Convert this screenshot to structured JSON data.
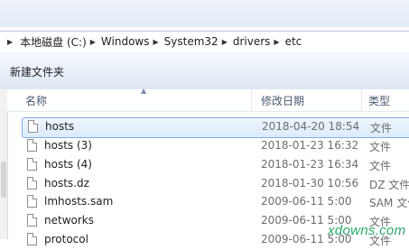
{
  "address": {
    "crumbs": [
      "本地磁盘 (C:)",
      "Windows",
      "System32",
      "drivers",
      "etc"
    ]
  },
  "toolbar": {
    "new_folder_label": "新建文件夹"
  },
  "columns": {
    "name": "名称",
    "date": "修改日期",
    "type": "类型"
  },
  "files": [
    {
      "name": "hosts",
      "date": "2018-04-20 18:54",
      "type": "文件",
      "selected": true
    },
    {
      "name": "hosts (3)",
      "date": "2018-01-23 16:32",
      "type": "文件"
    },
    {
      "name": "hosts (4)",
      "date": "2018-01-23 16:34",
      "type": "文件"
    },
    {
      "name": "hosts.dz",
      "date": "2018-01-30 10:56",
      "type": "DZ 文件"
    },
    {
      "name": "lmhosts.sam",
      "date": "2009-06-11 5:00",
      "type": "SAM 文件"
    },
    {
      "name": "networks",
      "date": "2009-06-11 5:00",
      "type": "文件"
    },
    {
      "name": "protocol",
      "date": "2009-06-11 5:00",
      "type": "文件"
    }
  ],
  "watermark": "xdowns.com",
  "icons": {
    "file": "file-icon",
    "arrow": "arrow-right-icon"
  }
}
